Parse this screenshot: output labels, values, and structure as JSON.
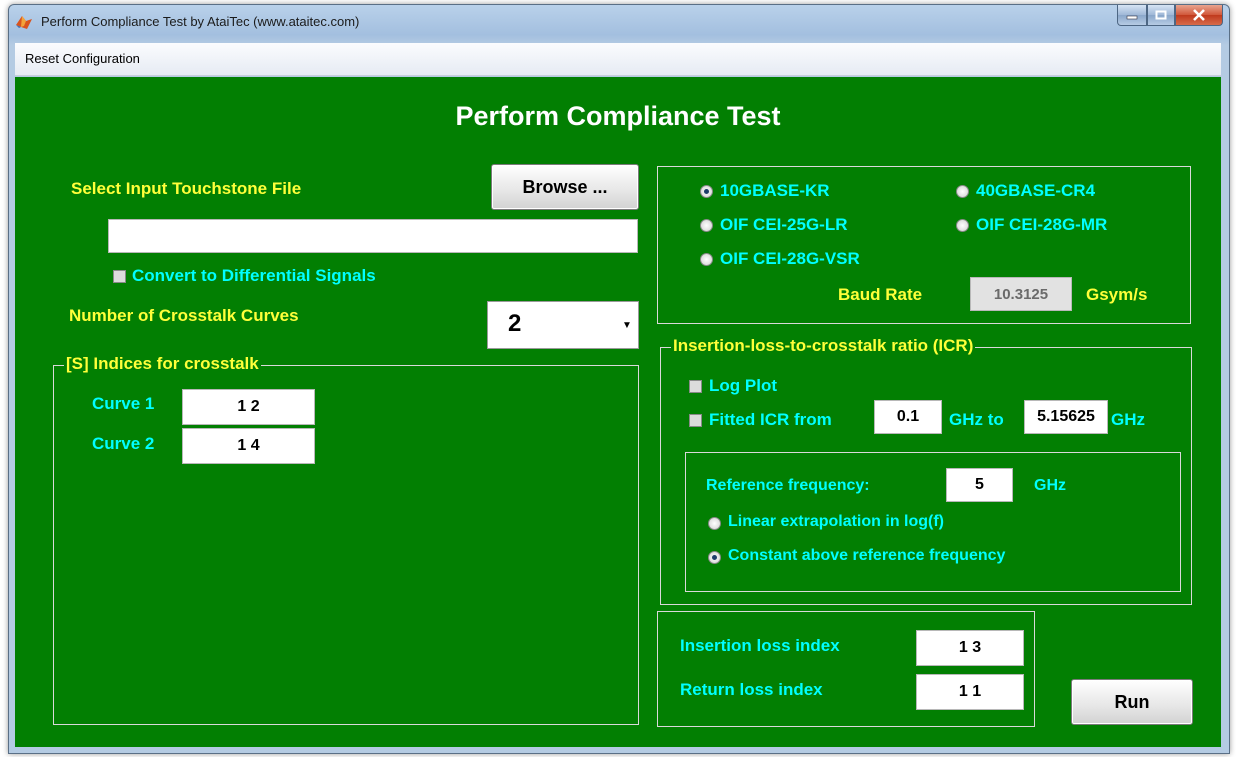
{
  "window": {
    "title": "Perform Compliance Test by AtaiTec (www.ataitec.com)"
  },
  "menu": {
    "reset": "Reset Configuration"
  },
  "main": {
    "heading": "Perform Compliance Test",
    "select_file_label": "Select Input Touchstone File",
    "browse_button": "Browse ...",
    "file_path_value": "",
    "convert_label": "Convert to Differential Signals",
    "crosstalk_curves_label": "Number of Crosstalk Curves",
    "crosstalk_curves_value": "2"
  },
  "indices_panel": {
    "title": "[S] Indices for crosstalk",
    "curves": [
      {
        "label": "Curve 1",
        "value": "1 2"
      },
      {
        "label": "Curve 2",
        "value": "1 4"
      }
    ]
  },
  "standards": {
    "options": [
      {
        "label": "10GBASE-KR",
        "selected": true
      },
      {
        "label": "40GBASE-CR4",
        "selected": false
      },
      {
        "label": "OIF CEI-25G-LR",
        "selected": false
      },
      {
        "label": "OIF CEI-28G-MR",
        "selected": false
      },
      {
        "label": "OIF CEI-28G-VSR",
        "selected": false
      }
    ],
    "baud_rate_label": "Baud Rate",
    "baud_rate_value": "10.3125",
    "baud_rate_unit": "Gsym/s"
  },
  "icr_panel": {
    "title": "Insertion-loss-to-crosstalk ratio (ICR)",
    "log_plot_label": "Log Plot",
    "fitted_label": "Fitted ICR from",
    "fitted_from_value": "0.1",
    "ghz_to_label": "GHz to",
    "fitted_to_value": "5.15625",
    "ghz_label": "GHz",
    "ref_freq_label": "Reference frequency:",
    "ref_freq_value": "5",
    "ref_freq_unit": "GHz",
    "linear_label": "Linear extrapolation in log(f)",
    "constant_label": "Constant above reference frequency"
  },
  "loss_panel": {
    "insertion_label": "Insertion loss index",
    "insertion_value": "1 3",
    "return_label": "Return loss index",
    "return_value": "1 1"
  },
  "run_button": "Run",
  "colors": {
    "background": "#027f02",
    "label_yellow": "#ffff3a",
    "label_cyan": "#00ffff"
  }
}
